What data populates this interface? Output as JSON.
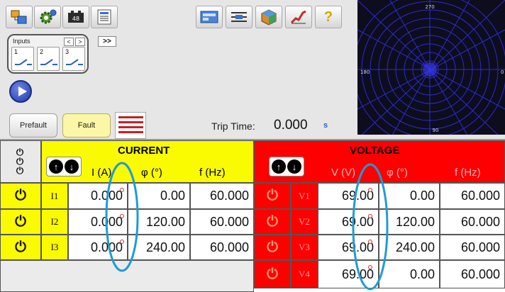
{
  "toolbar": {
    "icons": [
      "config-icon",
      "settings-gear-icon",
      "battery-icon",
      "report-icon",
      "test-module-icon",
      "sequence-icon",
      "cube-icon",
      "ramp-icon",
      "help-icon"
    ],
    "battery_label": "48",
    "help_label": "?"
  },
  "inputs": {
    "label": "Inputs",
    "prev": "<",
    "next": ">",
    "expand": ">>",
    "items": [
      {
        "num": "1"
      },
      {
        "num": "2"
      },
      {
        "num": "3"
      }
    ]
  },
  "modes": {
    "prefault": "Prefault",
    "fault": "Fault"
  },
  "trip": {
    "label": "Trip Time:",
    "value": "0.000",
    "unit": "s"
  },
  "vector": {
    "top": "270",
    "left": "180",
    "right": "0",
    "bottom": "90"
  },
  "current": {
    "title": "CURRENT",
    "col_i": "I (A)",
    "col_phi": "φ  (°)",
    "col_f": "f  (Hz)",
    "rows": [
      {
        "name": "I1",
        "i": "0.000",
        "phi": "0.00",
        "f": "60.000"
      },
      {
        "name": "I2",
        "i": "0.000",
        "phi": "120.00",
        "f": "60.000"
      },
      {
        "name": "I3",
        "i": "0.000",
        "phi": "240.00",
        "f": "60.000"
      }
    ]
  },
  "voltage": {
    "title": "VOLTAGE",
    "col_v": "V (V)",
    "col_phi": "φ  (°)",
    "col_f": "f  (Hz)",
    "rows": [
      {
        "name": "V1",
        "v": "69.00",
        "phi": "0.00",
        "f": "60.000"
      },
      {
        "name": "V2",
        "v": "69.00",
        "phi": "120.00",
        "f": "60.000"
      },
      {
        "name": "V3",
        "v": "69.00",
        "phi": "240.00",
        "f": "60.000"
      },
      {
        "name": "V4",
        "v": "69.00",
        "phi": "0.00",
        "f": "60.000"
      }
    ]
  },
  "colors": {
    "current_header": "#fafa00",
    "voltage_header": "#ff0000",
    "circle_annotation": "#1f9bd6"
  }
}
